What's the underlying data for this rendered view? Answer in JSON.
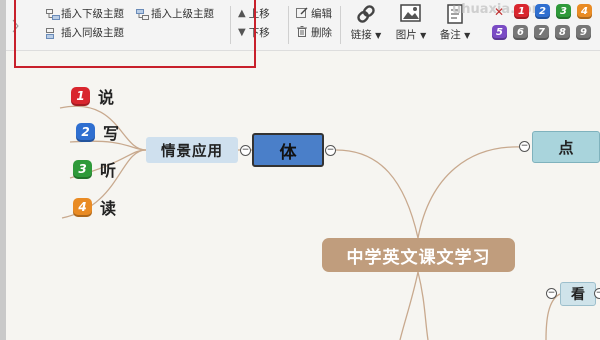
{
  "toolbar": {
    "insert_child": "插入下级主题",
    "insert_parent": "插入上级主题",
    "insert_sibling": "插入同级主题",
    "move_up": "上移",
    "move_down": "下移",
    "edit": "编辑",
    "delete": "删除",
    "link": "链接",
    "image": "图片",
    "note": "备注",
    "watermark": "uhuaxia.com",
    "priority_top": [
      "1",
      "2",
      "3",
      "4"
    ],
    "priority_bottom": [
      "5",
      "6",
      "7",
      "8",
      "9"
    ],
    "priority_colors_top": [
      "#d9262e",
      "#2f6fd0",
      "#2f9a3a",
      "#e98b24"
    ],
    "priority_colors_bottom": [
      "#7a4bc4",
      "#777777",
      "#777777",
      "#777777",
      "#777777"
    ]
  },
  "mindmap": {
    "central": "中学英文课文学习",
    "branch_left": "体",
    "subtopic": "情景应用",
    "leaves": [
      {
        "num": "1",
        "label": "说",
        "color": "#d9262e"
      },
      {
        "num": "2",
        "label": "写",
        "color": "#2f6fd0"
      },
      {
        "num": "3",
        "label": "听",
        "color": "#2f9a3a"
      },
      {
        "num": "4",
        "label": "读",
        "color": "#e98b24"
      }
    ],
    "branch_right_top": "点",
    "branch_right_bottom": "看"
  }
}
